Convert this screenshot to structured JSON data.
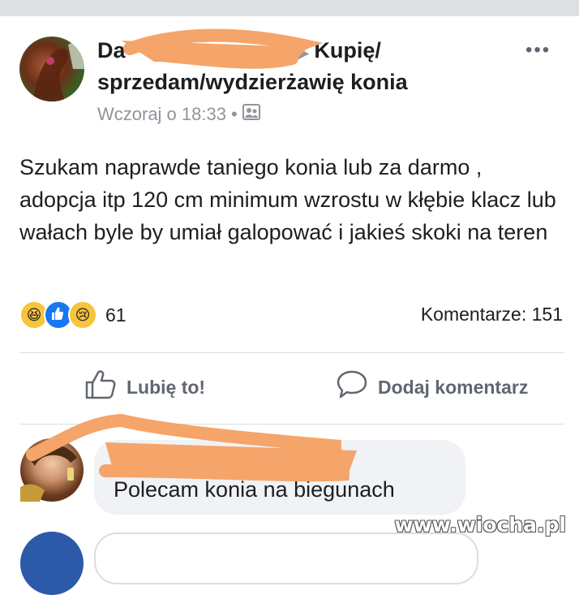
{
  "post": {
    "author_visible": "Da",
    "group": "Kupię/ sprzedam/wydzierżawię konia",
    "timestamp": "Wczoraj o 18:33",
    "separator": "•",
    "text": "Szukam naprawde taniego konia lub za darmo , adopcja itp 120 cm minimum wzrostu w kłębie klacz lub wałach byle by umiał galopować i jakieś skoki na teren",
    "reactions": [
      "haha",
      "like",
      "sad"
    ],
    "reaction_count": "61",
    "comments_count": "Komentarze: 151"
  },
  "actions": {
    "like": "Lubię to!",
    "comment": "Dodaj komentarz"
  },
  "comment": {
    "text": "Polecam konia na biegunach"
  },
  "watermark": "www.wiocha.pl",
  "colors": {
    "redaction": "#f5a46a",
    "accent": "#1877f2",
    "muted": "#90949c"
  }
}
